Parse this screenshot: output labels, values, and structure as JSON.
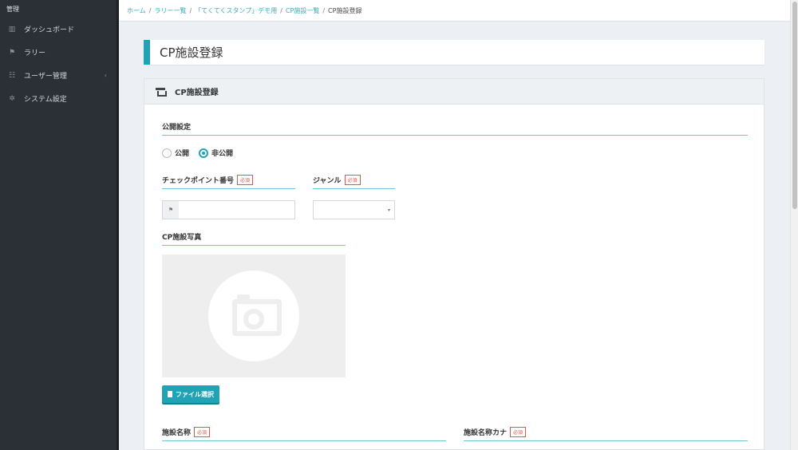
{
  "sidebar": {
    "header": "管理",
    "items": [
      {
        "icon": "chart-icon",
        "glyph": "▥",
        "label": "ダッシュボード"
      },
      {
        "icon": "flag-icon",
        "glyph": "⚑",
        "label": "ラリー"
      },
      {
        "icon": "users-icon",
        "glyph": "☷",
        "label": "ユーザー管理",
        "chevron": "‹"
      },
      {
        "icon": "gear-icon",
        "glyph": "✲",
        "label": "システム設定"
      }
    ]
  },
  "breadcrumb": {
    "items": [
      "ホーム",
      "ラリー一覧",
      "「てくてくスタンプ」デモ用",
      "CP施設一覧"
    ],
    "separator": "/",
    "current": "CP施設登録"
  },
  "page": {
    "title": "CP施設登録"
  },
  "card": {
    "title": "CP施設登録",
    "publish": {
      "label": "公開設定",
      "options": [
        "公開",
        "非公開"
      ],
      "selected": "非公開"
    },
    "checkpoint": {
      "label": "チェックポイント番号",
      "required": "必須",
      "addon": "⚑",
      "value": ""
    },
    "genre": {
      "label": "ジャンル",
      "required": "必須",
      "caret": "▾",
      "value": ""
    },
    "photo": {
      "label": "CP施設写真"
    },
    "file_button": "ファイル選択",
    "facility_name": {
      "label": "施設名称",
      "required": "必須"
    },
    "facility_kana": {
      "label": "施設名称カナ",
      "required": "必須"
    }
  },
  "colors": {
    "accent": "#1fa3b5",
    "sidebar": "#2b2f36",
    "required": "#e0544c"
  }
}
